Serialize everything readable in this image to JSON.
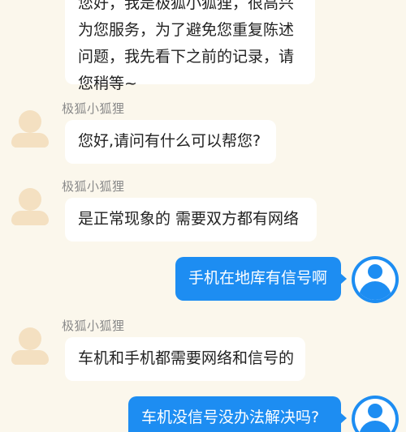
{
  "messages": [
    {
      "sender": "bot",
      "name": "",
      "lines": [
        "您好，我是极狐小狐狸，很高兴",
        "为您服务，为了避免您重复陈述",
        "问题，我先看下之前的记录，请",
        "您稍等~"
      ]
    },
    {
      "sender": "bot",
      "name": "极狐小狐狸",
      "text": "您好,请问有什么可以帮您?"
    },
    {
      "sender": "bot",
      "name": "极狐小狐狸",
      "text": "是正常现象的  需要双方都有网络"
    },
    {
      "sender": "user",
      "text": "手机在地库有信号啊"
    },
    {
      "sender": "bot",
      "name": "极狐小狐狸",
      "text": "车机和手机都需要网络和信号的"
    },
    {
      "sender": "user",
      "text": "车机没信号没办法解决吗?"
    }
  ],
  "colors": {
    "background": "#fbf7ec",
    "user_bubble": "#1d8df2",
    "bot_bubble": "#ffffff",
    "bot_avatar": "#f4e0c1",
    "name_text": "#8a8a8a"
  }
}
